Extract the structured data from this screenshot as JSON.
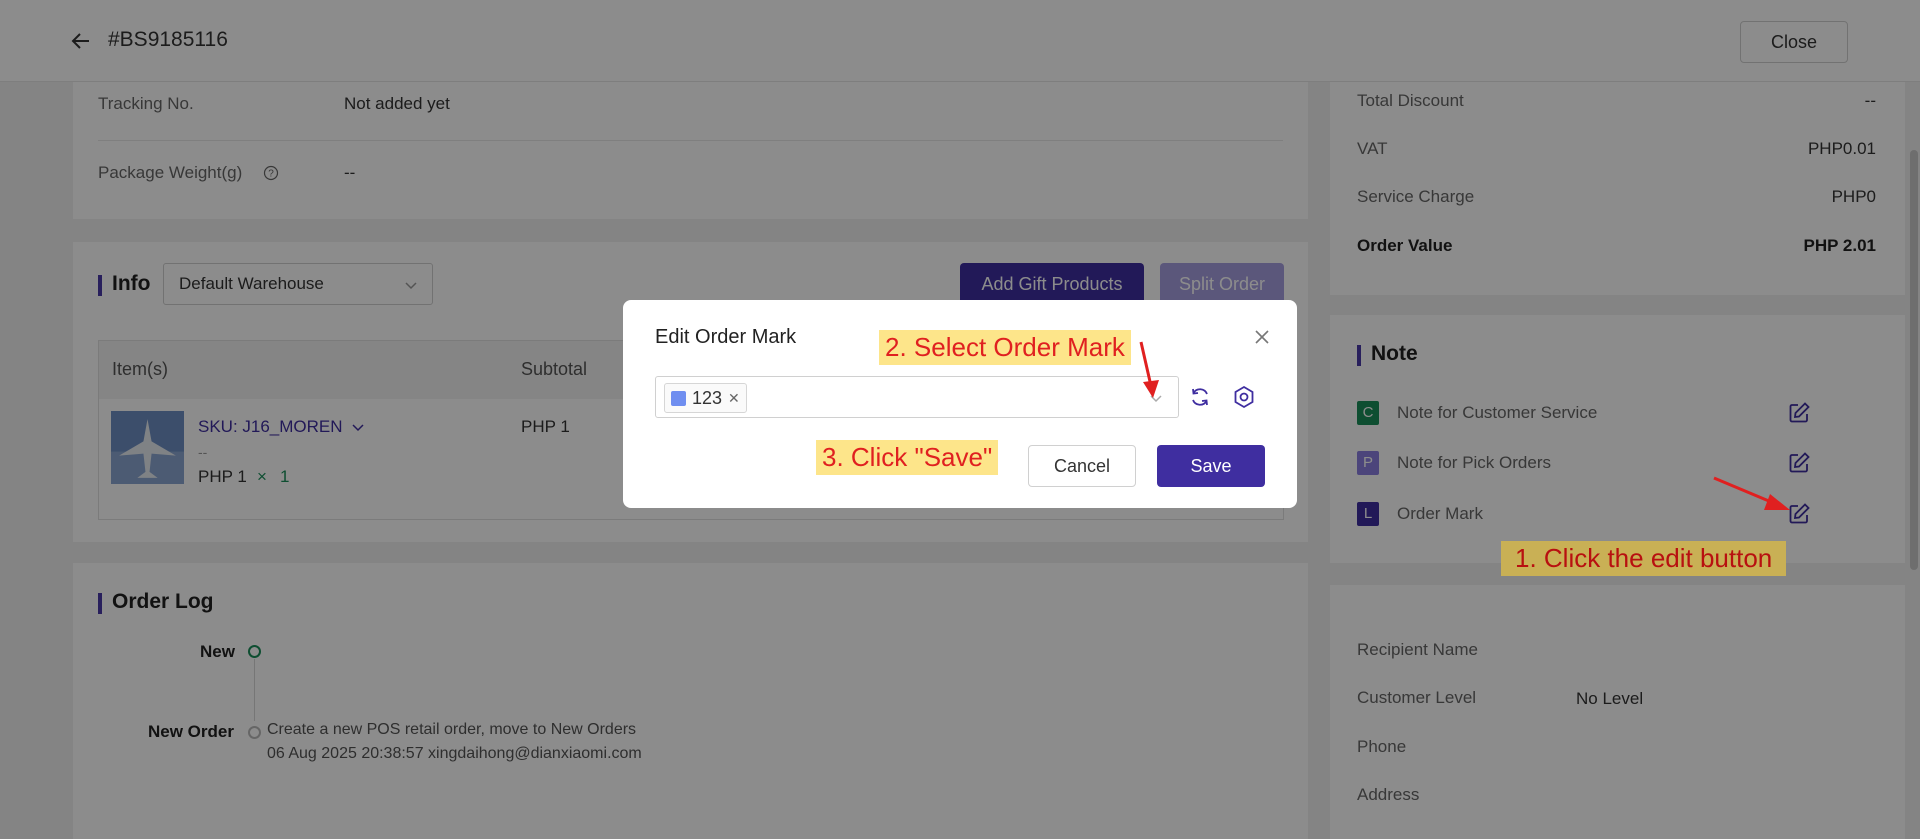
{
  "header": {
    "order_no": "#BS9185116",
    "close_label": "Close"
  },
  "shipping": {
    "tracking_label": "Tracking No.",
    "tracking_value": "Not added yet",
    "weight_label": "Package Weight(g)",
    "weight_value": "--"
  },
  "info": {
    "title": "Info",
    "warehouse": "Default Warehouse",
    "add_gift_label": "Add Gift Products",
    "split_order_label": "Split Order",
    "columns": [
      "Item(s)",
      "Subtotal"
    ],
    "item": {
      "sku": "SKU: J16_MOREN",
      "dash": "--",
      "price": "PHP 1",
      "qty_sep": "×",
      "qty": "1",
      "subtotal": "PHP 1"
    }
  },
  "order_log": {
    "title": "Order Log",
    "entries": [
      {
        "status": "New"
      },
      {
        "status": "New Order",
        "text": "Create a new POS retail order, move to New Orders",
        "meta": "06 Aug 2025 20:38:57 xingdaihong@dianxiaomi.com"
      }
    ]
  },
  "summary": {
    "rows": [
      {
        "label": "Total Discount",
        "value": "--"
      },
      {
        "label": "VAT",
        "value": "PHP0.01"
      },
      {
        "label": "Service Charge",
        "value": "PHP0"
      }
    ],
    "total_label": "Order Value",
    "total_value": "PHP 2.01"
  },
  "note": {
    "title": "Note",
    "items": [
      {
        "badge": "C",
        "label": "Note for Customer Service",
        "color": "#1a8f5a"
      },
      {
        "badge": "P",
        "label": "Note for Pick Orders",
        "color": "#8a7fe0"
      },
      {
        "badge": "L",
        "label": "Order Mark",
        "color": "#3f2ea0"
      }
    ]
  },
  "customer": {
    "recipient_label": "Recipient Name",
    "level_label": "Customer Level",
    "level_value": "No Level",
    "phone_label": "Phone",
    "address_label": "Address"
  },
  "modal": {
    "title": "Edit Order Mark",
    "tag_label": "123",
    "tag_color": "#6f8ef0",
    "cancel_label": "Cancel",
    "save_label": "Save"
  },
  "annotations": {
    "step1": "1. Click the edit button",
    "step2": "2. Select Order Mark",
    "step3": "3. Click \"Save\""
  },
  "colors": {
    "accent": "#3f2ea0",
    "success": "#1a8f5a",
    "annotation_red": "#e02020",
    "annotation_bg": "#fde58a"
  }
}
